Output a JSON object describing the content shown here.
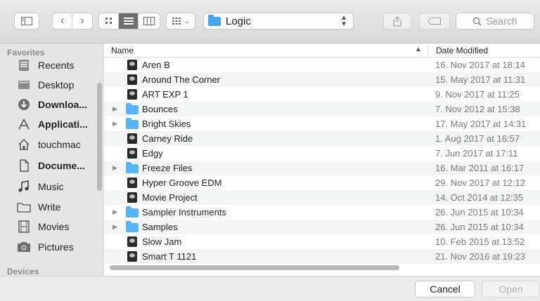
{
  "toolbar": {
    "location": "Logic",
    "search_placeholder": "Search"
  },
  "sidebar": {
    "favorites_label": "Favorites",
    "devices_label": "Devices",
    "items": [
      {
        "label": "Recents",
        "icon": "recents-icon"
      },
      {
        "label": "Desktop",
        "icon": "desktop-icon"
      },
      {
        "label": "Downloa...",
        "icon": "downloads-icon"
      },
      {
        "label": "Applicati...",
        "icon": "applications-icon"
      },
      {
        "label": "touchmac",
        "icon": "home-icon"
      },
      {
        "label": "Docume...",
        "icon": "documents-icon"
      },
      {
        "label": "Music",
        "icon": "music-icon"
      },
      {
        "label": "Write",
        "icon": "folder-icon"
      },
      {
        "label": "Movies",
        "icon": "movies-icon"
      },
      {
        "label": "Pictures",
        "icon": "pictures-icon"
      }
    ]
  },
  "list": {
    "col_name": "Name",
    "col_date": "Date Modified",
    "rows": [
      {
        "name": "Aren B",
        "date": "16. Nov 2017 at 18:14",
        "kind": "file"
      },
      {
        "name": "Around The Corner",
        "date": "15. May 2017 at 11:31",
        "kind": "file"
      },
      {
        "name": "ART EXP 1",
        "date": "9. Nov 2017 at 11:25",
        "kind": "file"
      },
      {
        "name": "Bounces",
        "date": "7. Nov 2012 at 15:38",
        "kind": "folder"
      },
      {
        "name": "Bright Skies",
        "date": "17. May 2017 at 14:31",
        "kind": "folder"
      },
      {
        "name": "Carney Ride",
        "date": "1. Aug 2017 at 16:57",
        "kind": "file"
      },
      {
        "name": "Edgy",
        "date": "7. Jun 2017 at 17:11",
        "kind": "file"
      },
      {
        "name": "Freeze Files",
        "date": "16. Mar 2011 at 16:17",
        "kind": "folder"
      },
      {
        "name": "Hyper Groove EDM",
        "date": "29. Nov 2017 at 12:12",
        "kind": "file"
      },
      {
        "name": "Movie Project",
        "date": "14. Oct 2014 at 12:35",
        "kind": "file"
      },
      {
        "name": "Sampler Instruments",
        "date": "26. Jun 2015 at 10:34",
        "kind": "folder"
      },
      {
        "name": "Samples",
        "date": "26. Jun 2015 at 10:34",
        "kind": "folder"
      },
      {
        "name": "Slow Jam",
        "date": "10. Feb 2015 at 13:52",
        "kind": "file"
      },
      {
        "name": "Smart T 1121",
        "date": "21. Nov 2016 at 19:23",
        "kind": "file"
      }
    ]
  },
  "buttons": {
    "cancel": "Cancel",
    "open": "Open"
  }
}
